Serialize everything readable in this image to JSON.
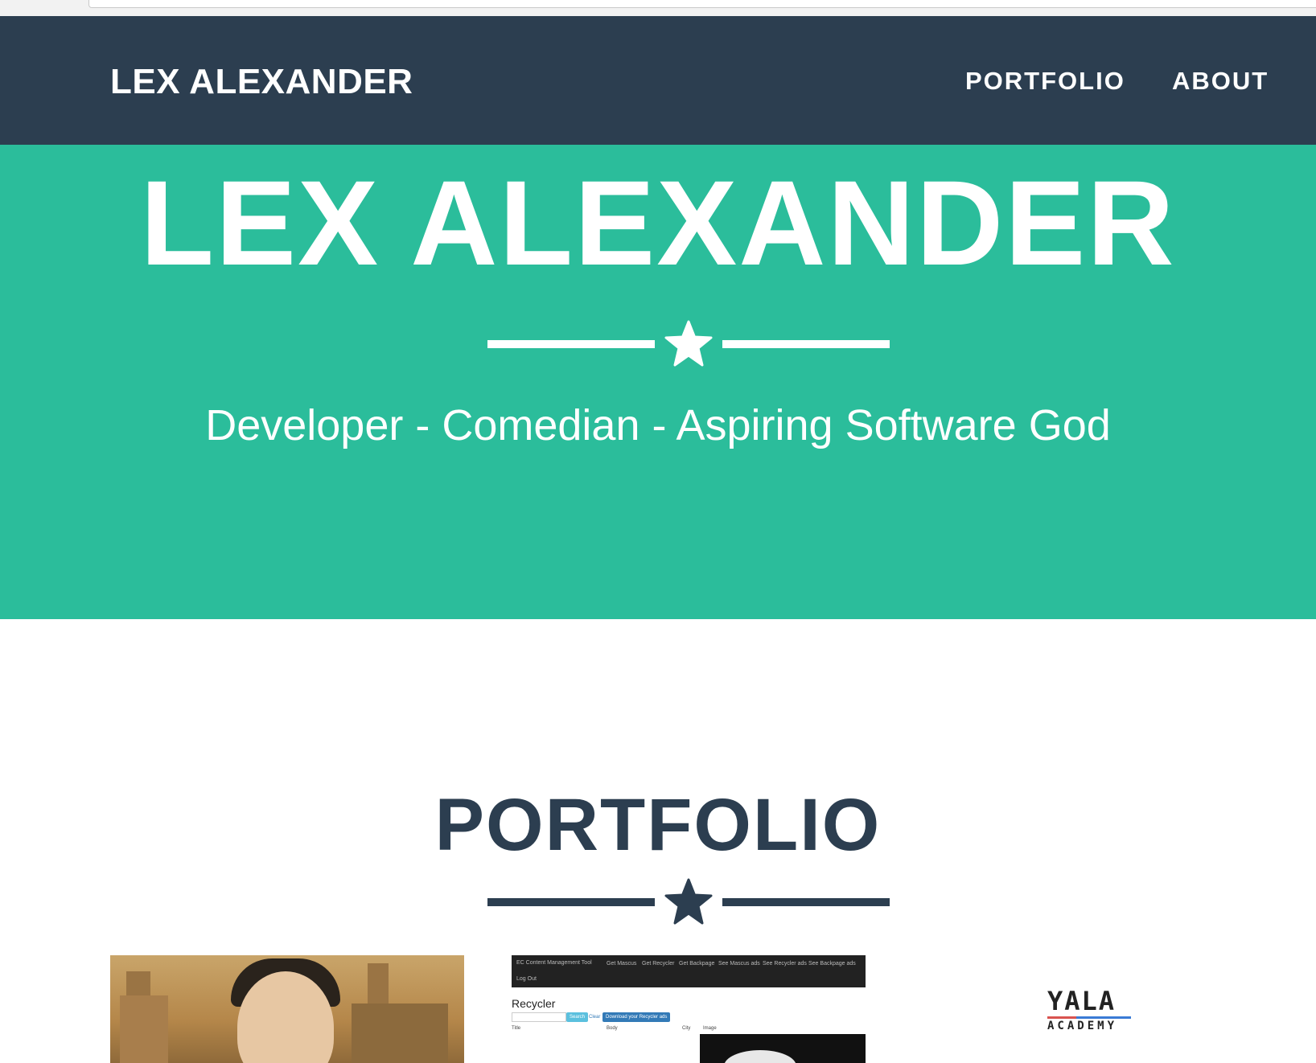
{
  "navbar": {
    "brand": "LEX ALEXANDER",
    "links": [
      "PORTFOLIO",
      "ABOUT"
    ],
    "background": "#2c3e50"
  },
  "hero": {
    "title": "LEX ALEXANDER",
    "subtitle": "Developer - Comedian - Aspiring Software God",
    "divider_icon": "star-icon",
    "background": "#2bbd9b"
  },
  "portfolio": {
    "title": "PORTFOLIO",
    "divider_icon": "star-icon",
    "title_color": "#2c3e50",
    "items": [
      {
        "icon": "painting-thumbnail"
      },
      {
        "cms": {
          "nav": [
            "EC Content Management Tool",
            "Get Mascus",
            "Get Recycler",
            "Get Backpage",
            "See Mascus ads",
            "See Recycler ads",
            "See Backpage ads",
            "Log Out"
          ],
          "heading": "Recycler",
          "search_label": "Search",
          "clear_label": "Clear",
          "download_label": "Download your Recycler ads",
          "columns": [
            "Title",
            "Body",
            "City",
            "Image"
          ]
        }
      },
      {
        "logo_top": "YALA",
        "logo_bottom": "ACADEMY"
      }
    ]
  }
}
